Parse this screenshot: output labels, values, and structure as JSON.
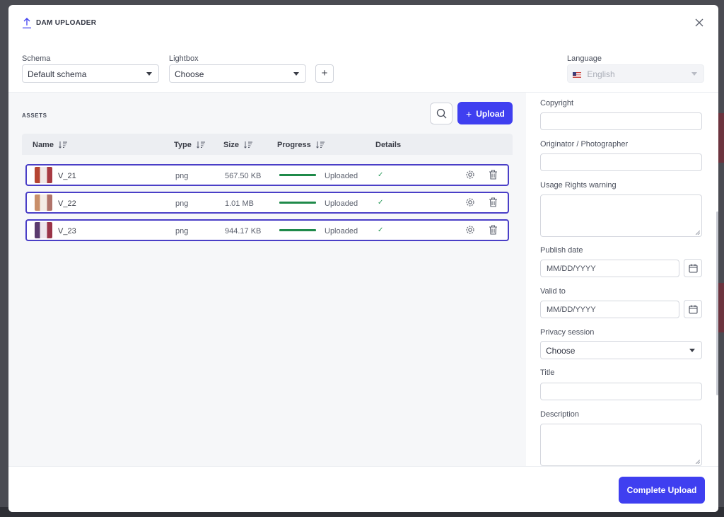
{
  "modal": {
    "title": "DAM UPLOADER"
  },
  "top": {
    "schema_label": "Schema",
    "schema_value": "Default schema",
    "lightbox_label": "Lightbox",
    "lightbox_value": "Choose",
    "add_lightbox": "+",
    "language_label": "Language",
    "language_value": "English"
  },
  "assets": {
    "title": "ASSETS",
    "upload_label": "Upload",
    "upload_plus": "+",
    "columns": {
      "name": "Name",
      "type": "Type",
      "size": "Size",
      "progress": "Progress",
      "details": "Details"
    },
    "rows": [
      {
        "name": "V_21",
        "type": "png",
        "size": "567.50 KB",
        "status": "Uploaded",
        "progress": 1.0,
        "check": "✓"
      },
      {
        "name": "V_22",
        "type": "png",
        "size": "1.01 MB",
        "status": "Uploaded",
        "progress": 1.0,
        "check": "✓"
      },
      {
        "name": "V_23",
        "type": "png",
        "size": "944.17 KB",
        "status": "Uploaded",
        "progress": 1.0,
        "check": "✓"
      }
    ]
  },
  "metadata": {
    "copyright_label": "Copyright",
    "copyright_value": "",
    "originator_label": "Originator / Photographer",
    "originator_value": "",
    "usage_label": "Usage Rights warning",
    "publish_label": "Publish date",
    "publish_placeholder": "MM/DD/YYYY",
    "valid_label": "Valid to",
    "valid_placeholder": "MM/DD/YYYY",
    "privacy_label": "Privacy session",
    "privacy_value": "Choose",
    "title_label": "Title",
    "title_value": "",
    "description_label": "Description"
  },
  "footer": {
    "complete_label": "Complete Upload"
  },
  "colors": {
    "accent": "#3f3ff0",
    "row_border": "#4a3fc7",
    "progress": "#1f8a4a"
  }
}
